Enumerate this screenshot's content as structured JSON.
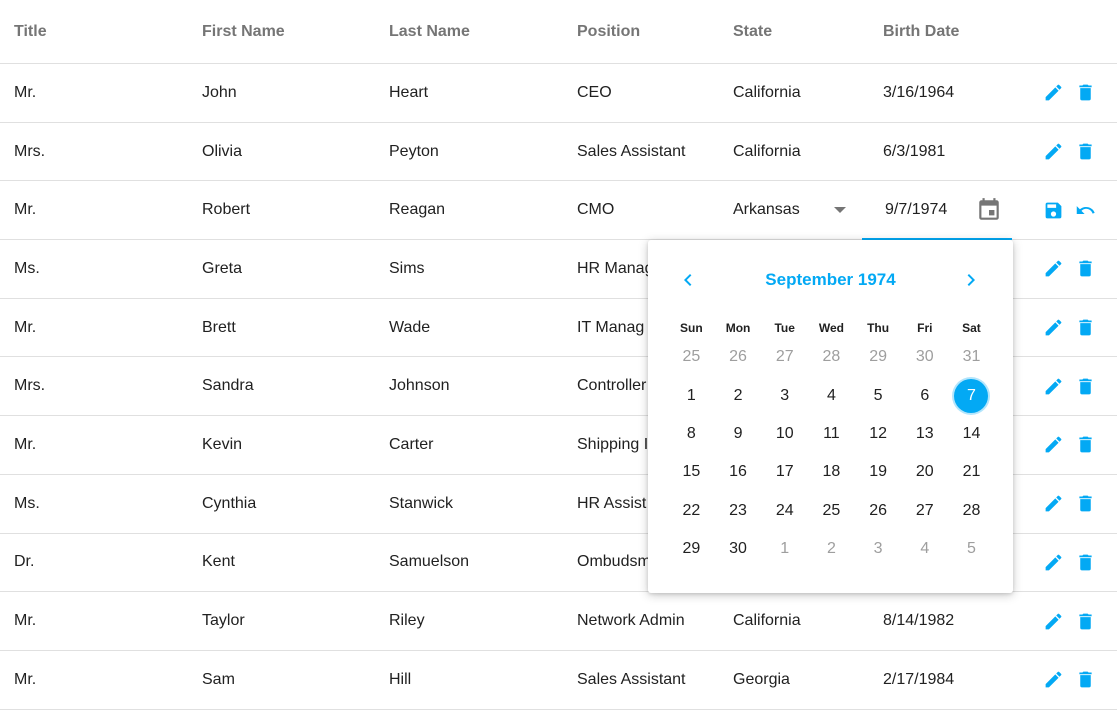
{
  "columns": [
    "Title",
    "First Name",
    "Last Name",
    "Position",
    "State",
    "Birth Date"
  ],
  "rows": [
    {
      "title": "Mr.",
      "first": "John",
      "last": "Heart",
      "position": "CEO",
      "state": "California",
      "birth": "3/16/1964"
    },
    {
      "title": "Mrs.",
      "first": "Olivia",
      "last": "Peyton",
      "position": "Sales Assistant",
      "state": "California",
      "birth": "6/3/1981"
    },
    {
      "title": "Mr.",
      "first": "Robert",
      "last": "Reagan",
      "position": "CMO",
      "state": "Arkansas",
      "birth": "9/7/1974"
    },
    {
      "title": "Ms.",
      "first": "Greta",
      "last": "Sims",
      "position": "HR Manag",
      "state": "",
      "birth": ""
    },
    {
      "title": "Mr.",
      "first": "Brett",
      "last": "Wade",
      "position": "IT Manag",
      "state": "",
      "birth": ""
    },
    {
      "title": "Mrs.",
      "first": "Sandra",
      "last": "Johnson",
      "position": "Controller",
      "state": "",
      "birth": ""
    },
    {
      "title": "Mr.",
      "first": "Kevin",
      "last": "Carter",
      "position": "Shipping I",
      "state": "",
      "birth": ""
    },
    {
      "title": "Ms.",
      "first": "Cynthia",
      "last": "Stanwick",
      "position": "HR Assist",
      "state": "",
      "birth": ""
    },
    {
      "title": "Dr.",
      "first": "Kent",
      "last": "Samuelson",
      "position": "Ombudsm",
      "state": "",
      "birth": ""
    },
    {
      "title": "Mr.",
      "first": "Taylor",
      "last": "Riley",
      "position": "Network Admin",
      "state": "California",
      "birth": "8/14/1982"
    },
    {
      "title": "Mr.",
      "first": "Sam",
      "last": "Hill",
      "position": "Sales Assistant",
      "state": "Georgia",
      "birth": "2/17/1984"
    }
  ],
  "editing_row": 2,
  "editor": {
    "state_value": "Arkansas",
    "date_value": "9/7/1974"
  },
  "calendar": {
    "caption": "September 1974",
    "weekdays": [
      "Sun",
      "Mon",
      "Tue",
      "Wed",
      "Thu",
      "Fri",
      "Sat"
    ],
    "weeks": [
      [
        {
          "d": "25",
          "o": true
        },
        {
          "d": "26",
          "o": true
        },
        {
          "d": "27",
          "o": true
        },
        {
          "d": "28",
          "o": true
        },
        {
          "d": "29",
          "o": true
        },
        {
          "d": "30",
          "o": true
        },
        {
          "d": "31",
          "o": true
        }
      ],
      [
        {
          "d": "1"
        },
        {
          "d": "2"
        },
        {
          "d": "3"
        },
        {
          "d": "4"
        },
        {
          "d": "5"
        },
        {
          "d": "6"
        },
        {
          "d": "7",
          "s": true
        }
      ],
      [
        {
          "d": "8"
        },
        {
          "d": "9"
        },
        {
          "d": "10"
        },
        {
          "d": "11"
        },
        {
          "d": "12"
        },
        {
          "d": "13"
        },
        {
          "d": "14"
        }
      ],
      [
        {
          "d": "15"
        },
        {
          "d": "16"
        },
        {
          "d": "17"
        },
        {
          "d": "18"
        },
        {
          "d": "19"
        },
        {
          "d": "20"
        },
        {
          "d": "21"
        }
      ],
      [
        {
          "d": "22"
        },
        {
          "d": "23"
        },
        {
          "d": "24"
        },
        {
          "d": "25"
        },
        {
          "d": "26"
        },
        {
          "d": "27"
        },
        {
          "d": "28"
        }
      ],
      [
        {
          "d": "29"
        },
        {
          "d": "30"
        },
        {
          "d": "1",
          "o": true
        },
        {
          "d": "2",
          "o": true
        },
        {
          "d": "3",
          "o": true
        },
        {
          "d": "4",
          "o": true
        },
        {
          "d": "5",
          "o": true
        }
      ]
    ]
  },
  "icons": {
    "row_actions": [
      "edit-icon",
      "delete-icon"
    ],
    "edit_actions": [
      "save-icon",
      "undo-icon"
    ],
    "date_picker": "calendar-icon",
    "prev": "chevron-left-icon",
    "next": "chevron-right-icon"
  },
  "colors": {
    "accent": "#03a9f4",
    "header_text": "#757575",
    "border": "#e0e0e0"
  }
}
